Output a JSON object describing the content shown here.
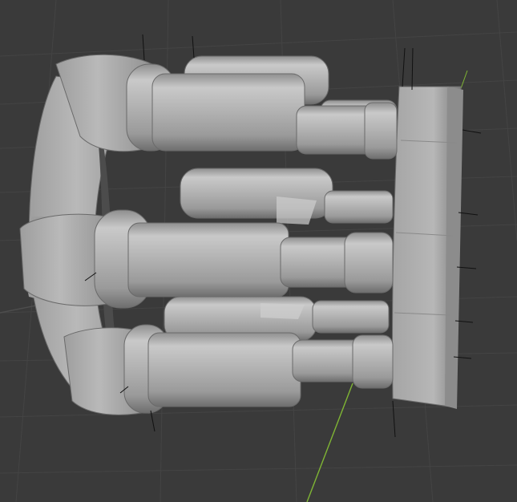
{
  "viewport": {
    "background": "#3a3a3a",
    "grid_color": "#444444",
    "axis_y_color": "#7fb534",
    "model_color": "#bdbdbd",
    "model_shade": "#8a8a8a",
    "model_highlight": "#d4d4d4"
  }
}
